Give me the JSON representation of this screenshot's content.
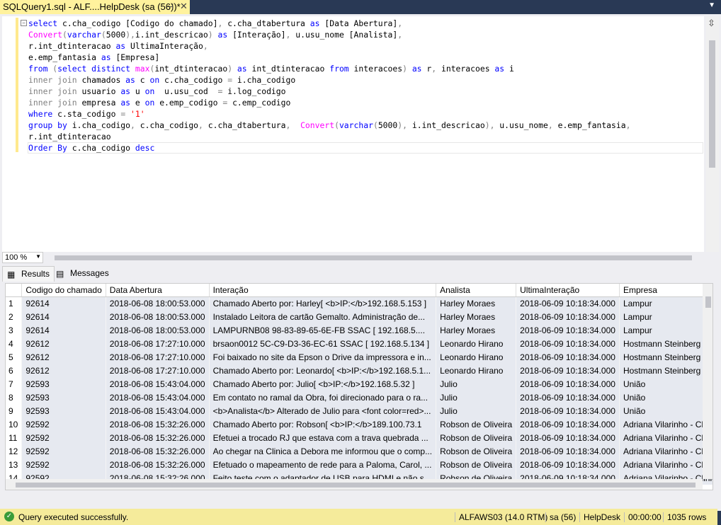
{
  "tab": {
    "title": "SQLQuery1.sql - ALF....HelpDesk (sa (56))*",
    "pin_icon": "pin-icon",
    "close_icon": "close-icon"
  },
  "colors": {
    "keyword": "#0000ff",
    "function": "#ff00ff",
    "operator": "#808080",
    "string": "#ff0000",
    "status_bar": "#f5eb9b",
    "chrome": "#293955"
  },
  "editor": {
    "lines": [
      [
        [
          "select ",
          "k"
        ],
        [
          "c.cha_codigo [Codigo do chamado]",
          "t"
        ],
        [
          ", ",
          "g"
        ],
        [
          "c.cha_dtabertura ",
          "t"
        ],
        [
          "as ",
          "k"
        ],
        [
          "[Data Abertura]",
          "t"
        ],
        [
          ",",
          "g"
        ]
      ],
      [
        [
          "Convert",
          "f"
        ],
        [
          "(",
          "g"
        ],
        [
          "varchar",
          "k"
        ],
        [
          "(",
          "g"
        ],
        [
          "5000",
          "t"
        ],
        [
          "),",
          "g"
        ],
        [
          "i.int_descricao",
          "t"
        ],
        [
          ") ",
          "g"
        ],
        [
          "as ",
          "k"
        ],
        [
          "[Interação]",
          "t"
        ],
        [
          ", ",
          "g"
        ],
        [
          "u.usu_nome [Analista]",
          "t"
        ],
        [
          ",",
          "g"
        ]
      ],
      [
        [
          "r.int_dtinteracao ",
          "t"
        ],
        [
          "as ",
          "k"
        ],
        [
          "UltimaInteração",
          "t"
        ],
        [
          ",",
          "g"
        ]
      ],
      [
        [
          "e.emp_fantasia ",
          "t"
        ],
        [
          "as ",
          "k"
        ],
        [
          "[Empresa]",
          "t"
        ]
      ],
      [
        [
          "from ",
          "k"
        ],
        [
          "(",
          "g"
        ],
        [
          "select distinct ",
          "k"
        ],
        [
          "max",
          "f"
        ],
        [
          "(",
          "g"
        ],
        [
          "int_dtinteracao",
          "t"
        ],
        [
          ") ",
          "g"
        ],
        [
          "as ",
          "k"
        ],
        [
          "int_dtinteracao ",
          "t"
        ],
        [
          "from ",
          "k"
        ],
        [
          "interacoes",
          "t"
        ],
        [
          ") ",
          "g"
        ],
        [
          "as ",
          "k"
        ],
        [
          "r",
          "t"
        ],
        [
          ", ",
          "g"
        ],
        [
          "interacoes ",
          "t"
        ],
        [
          "as ",
          "k"
        ],
        [
          "i",
          "t"
        ]
      ],
      [
        [
          "inner join ",
          "g"
        ],
        [
          "chamados ",
          "t"
        ],
        [
          "as ",
          "k"
        ],
        [
          "c ",
          "t"
        ],
        [
          "on ",
          "k"
        ],
        [
          "c.cha_codigo ",
          "t"
        ],
        [
          "= ",
          "g"
        ],
        [
          "i.cha_codigo",
          "t"
        ]
      ],
      [
        [
          "inner join ",
          "g"
        ],
        [
          "usuario ",
          "t"
        ],
        [
          "as ",
          "k"
        ],
        [
          "u ",
          "t"
        ],
        [
          "on  ",
          "k"
        ],
        [
          "u.usu_cod  ",
          "t"
        ],
        [
          "= ",
          "g"
        ],
        [
          "i.log_codigo",
          "t"
        ]
      ],
      [
        [
          "inner join ",
          "g"
        ],
        [
          "empresa ",
          "t"
        ],
        [
          "as ",
          "k"
        ],
        [
          "e ",
          "t"
        ],
        [
          "on ",
          "k"
        ],
        [
          "e.emp_codigo ",
          "t"
        ],
        [
          "= ",
          "g"
        ],
        [
          "c.emp_codigo",
          "t"
        ]
      ],
      [
        [
          "where ",
          "k"
        ],
        [
          "c.sta_codigo ",
          "t"
        ],
        [
          "= ",
          "g"
        ],
        [
          "'1'",
          "s"
        ]
      ],
      [
        [
          "group by ",
          "k"
        ],
        [
          "i.cha_codigo",
          "t"
        ],
        [
          ", ",
          "g"
        ],
        [
          "c.cha_codigo",
          "t"
        ],
        [
          ", ",
          "g"
        ],
        [
          "c.cha_dtabertura",
          "t"
        ],
        [
          ",  ",
          "g"
        ],
        [
          "Convert",
          "f"
        ],
        [
          "(",
          "g"
        ],
        [
          "varchar",
          "k"
        ],
        [
          "(",
          "g"
        ],
        [
          "5000",
          "t"
        ],
        [
          "), ",
          "g"
        ],
        [
          "i.int_descricao",
          "t"
        ],
        [
          "), ",
          "g"
        ],
        [
          "u.usu_nome",
          "t"
        ],
        [
          ", ",
          "g"
        ],
        [
          "e.emp_fantasia",
          "t"
        ],
        [
          ",",
          "g"
        ]
      ],
      [
        [
          "r.int_dtinteracao",
          "t"
        ]
      ],
      [
        [
          "Order By ",
          "k"
        ],
        [
          "c.cha_codigo ",
          "t"
        ],
        [
          "desc",
          "k"
        ]
      ]
    ]
  },
  "zoom": {
    "value": "100 %"
  },
  "results_tabs": [
    {
      "label": "Results",
      "icon": "grid-icon"
    },
    {
      "label": "Messages",
      "icon": "messages-icon"
    }
  ],
  "grid": {
    "columns": [
      "",
      "Codigo do chamado",
      "Data Abertura",
      "Interação",
      "Analista",
      "UltimaInteração",
      "Empresa"
    ],
    "rows": [
      [
        "1",
        "92614",
        "2018-06-08 18:00:53.000",
        "Chamado Aberto por: Harley[ <b>IP:</b>192.168.5.153 ]",
        "Harley Moraes",
        "2018-06-09 10:18:34.000",
        "Lampur"
      ],
      [
        "2",
        "92614",
        "2018-06-08 18:00:53.000",
        "Instalado Leitora de cartão Gemalto.    Administração de...",
        "Harley Moraes",
        "2018-06-09 10:18:34.000",
        "Lampur"
      ],
      [
        "3",
        "92614",
        "2018-06-08 18:00:53.000",
        "LAMPURNB08  98-83-89-65-6E-FB  SSAC [ 192.168.5....",
        "Harley Moraes",
        "2018-06-09 10:18:34.000",
        "Lampur"
      ],
      [
        "4",
        "92612",
        "2018-06-08 17:27:10.000",
        "brsaon0012  5C-C9-D3-36-EC-61  SSAC [ 192.168.5.134 ]",
        "Leonardo Hirano",
        "2018-06-09 10:18:34.000",
        "Hostmann Steinberg Tintas Grafica"
      ],
      [
        "5",
        "92612",
        "2018-06-08 17:27:10.000",
        "Foi baixado no site da Epson o Drive da impressora e in...",
        "Leonardo Hirano",
        "2018-06-09 10:18:34.000",
        "Hostmann Steinberg Tintas Grafica"
      ],
      [
        "6",
        "92612",
        "2018-06-08 17:27:10.000",
        "Chamado Aberto por: Leonardo[ <b>IP:</b>192.168.5.1...",
        "Leonardo Hirano",
        "2018-06-09 10:18:34.000",
        "Hostmann Steinberg Tintas Grafica"
      ],
      [
        "7",
        "92593",
        "2018-06-08 15:43:04.000",
        "Chamado Aberto por: Julio[ <b>IP:</b>192.168.5.32 ]",
        "Julio",
        "2018-06-09 10:18:34.000",
        "União"
      ],
      [
        "8",
        "92593",
        "2018-06-08 15:43:04.000",
        "Em contato no ramal da Obra, foi direcionado para o ra...",
        "Julio",
        "2018-06-09 10:18:34.000",
        "União"
      ],
      [
        "9",
        "92593",
        "2018-06-08 15:43:04.000",
        "<b>Analista</b> Alterado de Julio para <font color=red>...",
        "Julio",
        "2018-06-09 10:18:34.000",
        "União"
      ],
      [
        "10",
        "92592",
        "2018-06-08 15:32:26.000",
        "Chamado Aberto por: Robson[ <b>IP:</b>189.100.73.1",
        "Robson de Oliveira",
        "2018-06-09 10:18:34.000",
        "Adriana Vilarinho - Clinica"
      ],
      [
        "11",
        "92592",
        "2018-06-08 15:32:26.000",
        "Efetuei a trocado RJ que estava com a trava quebrada ...",
        "Robson de Oliveira",
        "2018-06-09 10:18:34.000",
        "Adriana Vilarinho - Clinica"
      ],
      [
        "12",
        "92592",
        "2018-06-08 15:32:26.000",
        "Ao chegar na Clinica a Debora me informou que o comp...",
        "Robson de Oliveira",
        "2018-06-09 10:18:34.000",
        "Adriana Vilarinho - Clinica"
      ],
      [
        "13",
        "92592",
        "2018-06-08 15:32:26.000",
        "Efetuado o mapeamento de rede para a Paloma, Carol, ...",
        "Robson de Oliveira",
        "2018-06-09 10:18:34.000",
        "Adriana Vilarinho - Clinica"
      ],
      [
        "14",
        "92592",
        "2018-06-08 15:32:26.000",
        "Feito teste com o adaptador de USB para HDMI e não s",
        "Robson de Oliveira",
        "2018-06-09 10:18:34.000",
        "Adriana Vilarinho - Clinica"
      ]
    ]
  },
  "status": {
    "message": "Query executed successfully.",
    "server": "ALFAWS03 (14.0 RTM)",
    "user": "sa (56)",
    "database": "HelpDesk",
    "elapsed": "00:00:00",
    "rows": "1035 rows"
  }
}
